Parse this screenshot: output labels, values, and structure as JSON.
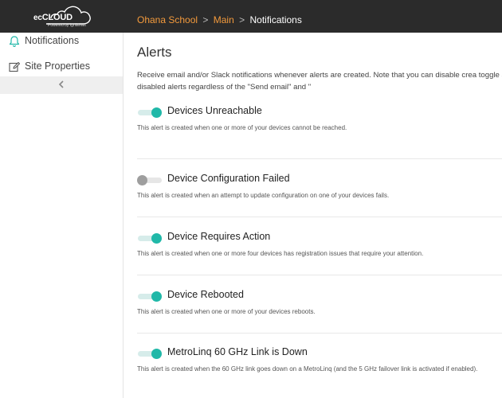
{
  "header": {
    "logo_brand_prefix": "ec",
    "logo_brand_main": "CLOUD",
    "logo_tagline": "Powered by IgniteNet",
    "breadcrumb": {
      "org": "Ohana School",
      "site": "Main",
      "current": "Notifications"
    },
    "colors": {
      "bar": "#2b2b2b",
      "link": "#f39a3c"
    }
  },
  "sidebar": {
    "items": [
      {
        "label": "Notifications",
        "icon": "bell-icon"
      },
      {
        "label": "Site Properties",
        "icon": "edit-icon"
      }
    ],
    "collapse_icon": "chevron-left-icon"
  },
  "main": {
    "title": "Alerts",
    "description": "Receive email and/or Slack notifications whenever alerts are created. Note that you can disable crea toggle switches. No notifications will be sent for disabled alerts regardless of the \"Send email\" and \"",
    "accent_color": "#20b8a8",
    "alerts": [
      {
        "name": "Devices Unreachable",
        "enabled": true,
        "description": "This alert is created when one or more of your devices cannot be reached."
      },
      {
        "name": "Device Configuration Failed",
        "enabled": false,
        "description": "This alert is created when an attempt to update configuration on one of your devices fails."
      },
      {
        "name": "Device Requires Action",
        "enabled": true,
        "description": "This alert is created when one or more four devices has registration issues that require your attention."
      },
      {
        "name": "Device Rebooted",
        "enabled": true,
        "description": "This alert is created when one or more of your devices reboots."
      },
      {
        "name": "MetroLinq 60 GHz Link is Down",
        "enabled": true,
        "description": "This alert is created when the 60 GHz link goes down on a MetroLinq (and the 5 GHz failover link is activated if enabled)."
      }
    ]
  }
}
